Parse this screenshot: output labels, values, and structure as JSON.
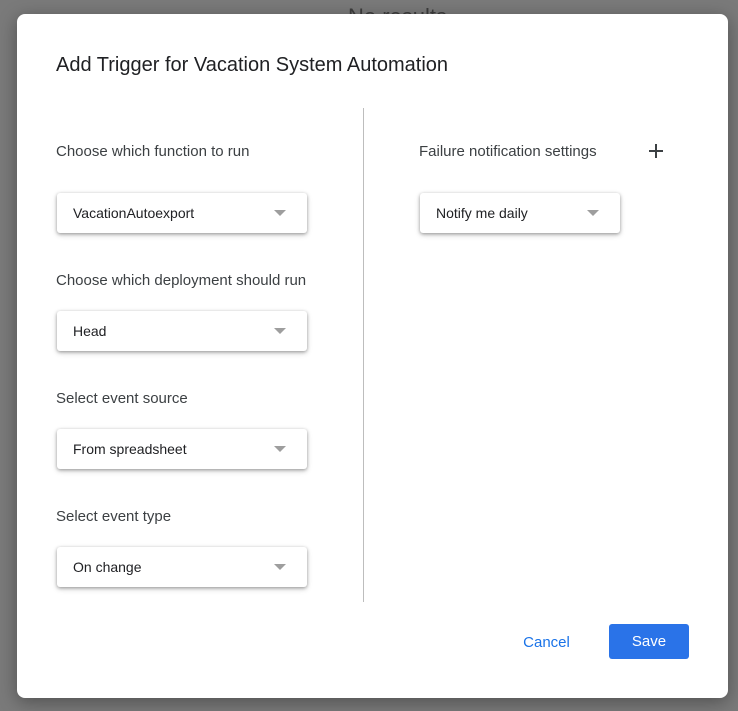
{
  "backdrop": {
    "partial_text": "No results"
  },
  "dialog": {
    "title": "Add Trigger for Vacation System Automation",
    "left_column": {
      "function_label": "Choose which function to run",
      "function_value": "VacationAutoexport",
      "deployment_label": "Choose which deployment should run",
      "deployment_value": "Head",
      "event_source_label": "Select event source",
      "event_source_value": "From spreadsheet",
      "event_type_label": "Select event type",
      "event_type_value": "On change"
    },
    "right_column": {
      "failure_label": "Failure notification settings",
      "failure_value": "Notify me daily",
      "add_icon": "plus-icon"
    },
    "actions": {
      "cancel_label": "Cancel",
      "save_label": "Save"
    },
    "colors": {
      "accent": "#1a73e8",
      "save_bg": "#2a73e8"
    }
  }
}
